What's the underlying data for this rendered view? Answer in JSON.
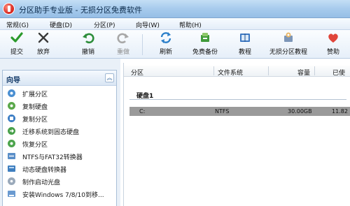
{
  "window": {
    "title": "分区助手专业版 - 无损分区免费软件"
  },
  "menu": [
    {
      "label": "常规(G)",
      "icon": "chevron-down-icon"
    },
    {
      "label": "硬盘(D)",
      "icon": "chevron-down-icon"
    },
    {
      "label": "分区(P)",
      "icon": "chevron-down-icon"
    },
    {
      "label": "向导(W)",
      "icon": "chevron-down-icon"
    },
    {
      "label": "帮助(H)",
      "icon": "chevron-down-icon"
    }
  ],
  "toolbar": {
    "submit": "提交",
    "discard": "放弃",
    "undo": "撤销",
    "redo": "重做",
    "refresh": "刷新",
    "free_backup": "免费备份",
    "tutorial": "教程",
    "lossless_tutorial": "无损分区教程",
    "sponsor": "赞助"
  },
  "wizard": {
    "title": "向导",
    "collapse_icon": "double-chevron-up-icon",
    "items": [
      {
        "label": "扩展分区",
        "icon": "extend-partition-icon"
      },
      {
        "label": "复制硬盘",
        "icon": "copy-disk-icon"
      },
      {
        "label": "复制分区",
        "icon": "copy-partition-icon"
      },
      {
        "label": "迁移系统到固态硬盘",
        "icon": "migrate-ssd-icon"
      },
      {
        "label": "恢复分区",
        "icon": "recover-partition-icon"
      },
      {
        "label": "NTFS与FAT32转换器",
        "icon": "convert-icon"
      },
      {
        "label": "动态硬盘转换器",
        "icon": "dynamic-disk-icon"
      },
      {
        "label": "制作启动光盘",
        "icon": "boot-disc-icon"
      },
      {
        "label": "安装Windows 7/8/10到移...",
        "icon": "install-windows-icon"
      }
    ]
  },
  "partition_table": {
    "columns": [
      "分区",
      "文件系统",
      "容量",
      "已使"
    ],
    "disk_label": "硬盘1",
    "rows": [
      {
        "partition": "C:",
        "filesystem": "NTFS",
        "capacity": "30.00GB",
        "used": "11.82"
      }
    ]
  },
  "colors": {
    "titlebar": "#a7cbed",
    "selected_row": "#9a9a9a",
    "accent": "#153b69"
  }
}
